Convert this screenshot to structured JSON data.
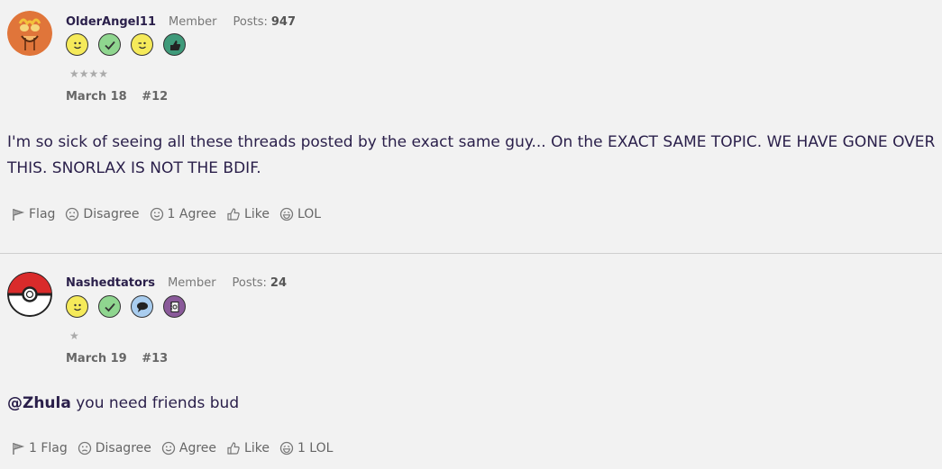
{
  "posts": [
    {
      "username": "OlderAngel11",
      "role": "Member",
      "posts_label": "Posts:",
      "posts_count": "947",
      "badges": [
        "smiley-badge-icon",
        "checkmark-badge-icon",
        "wink-badge-icon",
        "thumbs-up-badge-icon"
      ],
      "stars": "★★★★",
      "date": "March 18",
      "post_number": "#12",
      "body": "I'm so sick of seeing all these threads posted by the exact same guy... On the EXACT SAME TOPIC. WE HAVE GONE OVER THIS. SNORLAX IS NOT THE BDIF.",
      "actions": {
        "flag": "Flag",
        "disagree": "Disagree",
        "agree": "1 Agree",
        "like": "Like",
        "lol": "LOL"
      }
    },
    {
      "username": "Nashedtators",
      "role": "Member",
      "posts_label": "Posts:",
      "posts_count": "24",
      "badges": [
        "smiley-badge-icon",
        "checkmark-badge-icon",
        "speech-bubble-badge-icon",
        "notebook-badge-icon"
      ],
      "stars": "★",
      "date": "March 19",
      "post_number": "#13",
      "mention": "@Zhula",
      "body": " you need friends bud",
      "actions": {
        "flag": "1 Flag",
        "disagree": "Disagree",
        "agree": "Agree",
        "like": "Like",
        "lol": "1 LOL"
      }
    }
  ],
  "colors": {
    "background": "#f2f2f2",
    "text": "#2a1f4a",
    "muted": "#666666",
    "badge_yellow": "#f5ea5a",
    "badge_green": "#8fd68f",
    "badge_blue": "#a9cdef",
    "badge_purple": "#8a5a9a",
    "badge_teal": "#3f9a7a"
  }
}
